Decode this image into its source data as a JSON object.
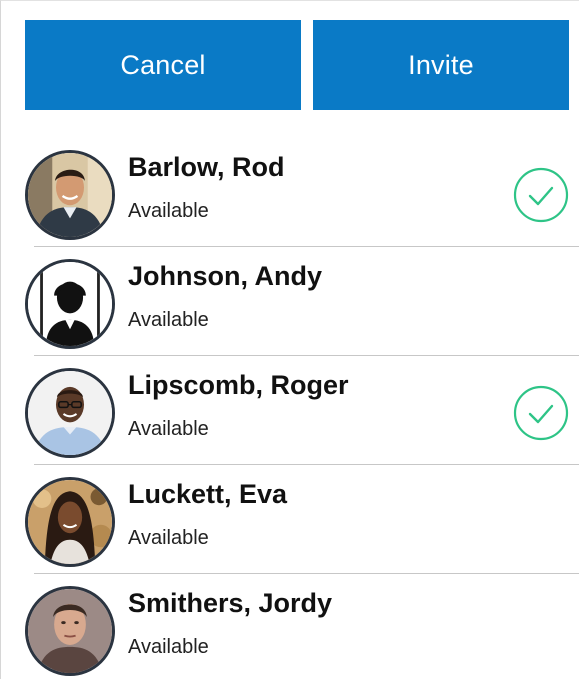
{
  "actions": {
    "cancel_label": "Cancel",
    "invite_label": "Invite"
  },
  "colors": {
    "primary": "#0a7ac6",
    "check": "#2ec487",
    "avatar_ring": "#2b3440",
    "divider": "#c7c7c7"
  },
  "contacts": [
    {
      "name": "Barlow, Rod",
      "status": "Available",
      "selected": true,
      "avatar": "photo-man-smiling-icon"
    },
    {
      "name": "Johnson, Andy",
      "status": "Available",
      "selected": false,
      "avatar": "default-person-silhouette-icon"
    },
    {
      "name": "Lipscomb, Roger",
      "status": "Available",
      "selected": true,
      "avatar": "photo-man-glasses-icon"
    },
    {
      "name": "Luckett, Eva",
      "status": "Available",
      "selected": false,
      "avatar": "photo-woman-braids-icon"
    },
    {
      "name": "Smithers, Jordy",
      "status": "Available",
      "selected": false,
      "avatar": "photo-young-man-icon"
    }
  ]
}
